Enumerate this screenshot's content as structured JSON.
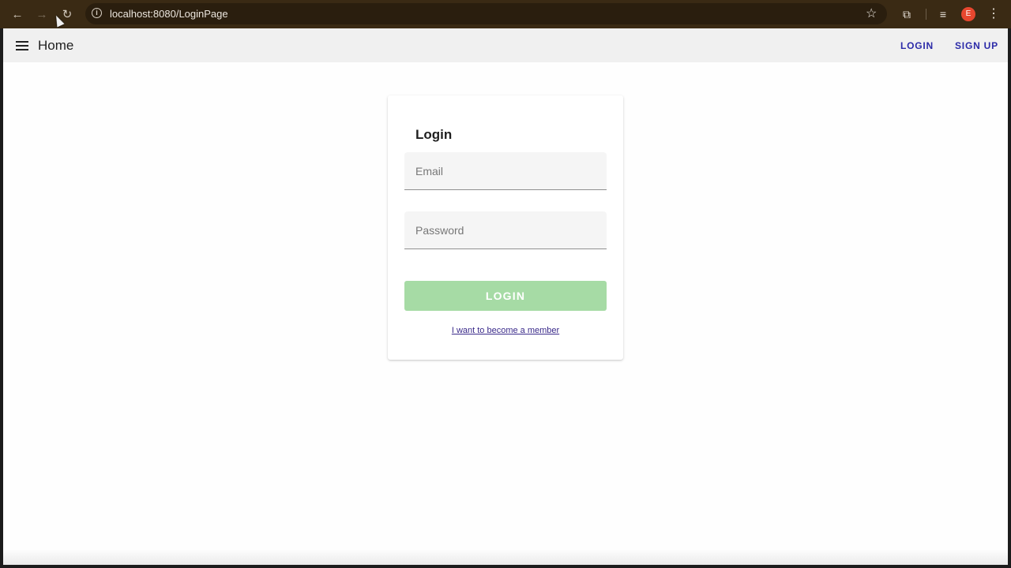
{
  "browser": {
    "url": "localhost:8080/LoginPage",
    "back_icon": "←",
    "forward_icon": "→",
    "reload_icon": "↻",
    "info_icon": "i",
    "star_icon": "☆",
    "extensions_icon": "⧉",
    "media_icon": "≡",
    "profile_initial": "E",
    "menu_icon": "⋮"
  },
  "app_bar": {
    "title": "Home",
    "login_link": "LOGIN",
    "signup_link": "SIGN UP"
  },
  "login_card": {
    "title": "Login",
    "email_placeholder": "Email",
    "password_placeholder": "Password",
    "login_button": "LOGIN",
    "member_link": "I want to become a member"
  },
  "colors": {
    "accent": "#2b2aa8",
    "button_disabled_green": "#a6dba5",
    "browser_chrome": "#3a2a14"
  }
}
